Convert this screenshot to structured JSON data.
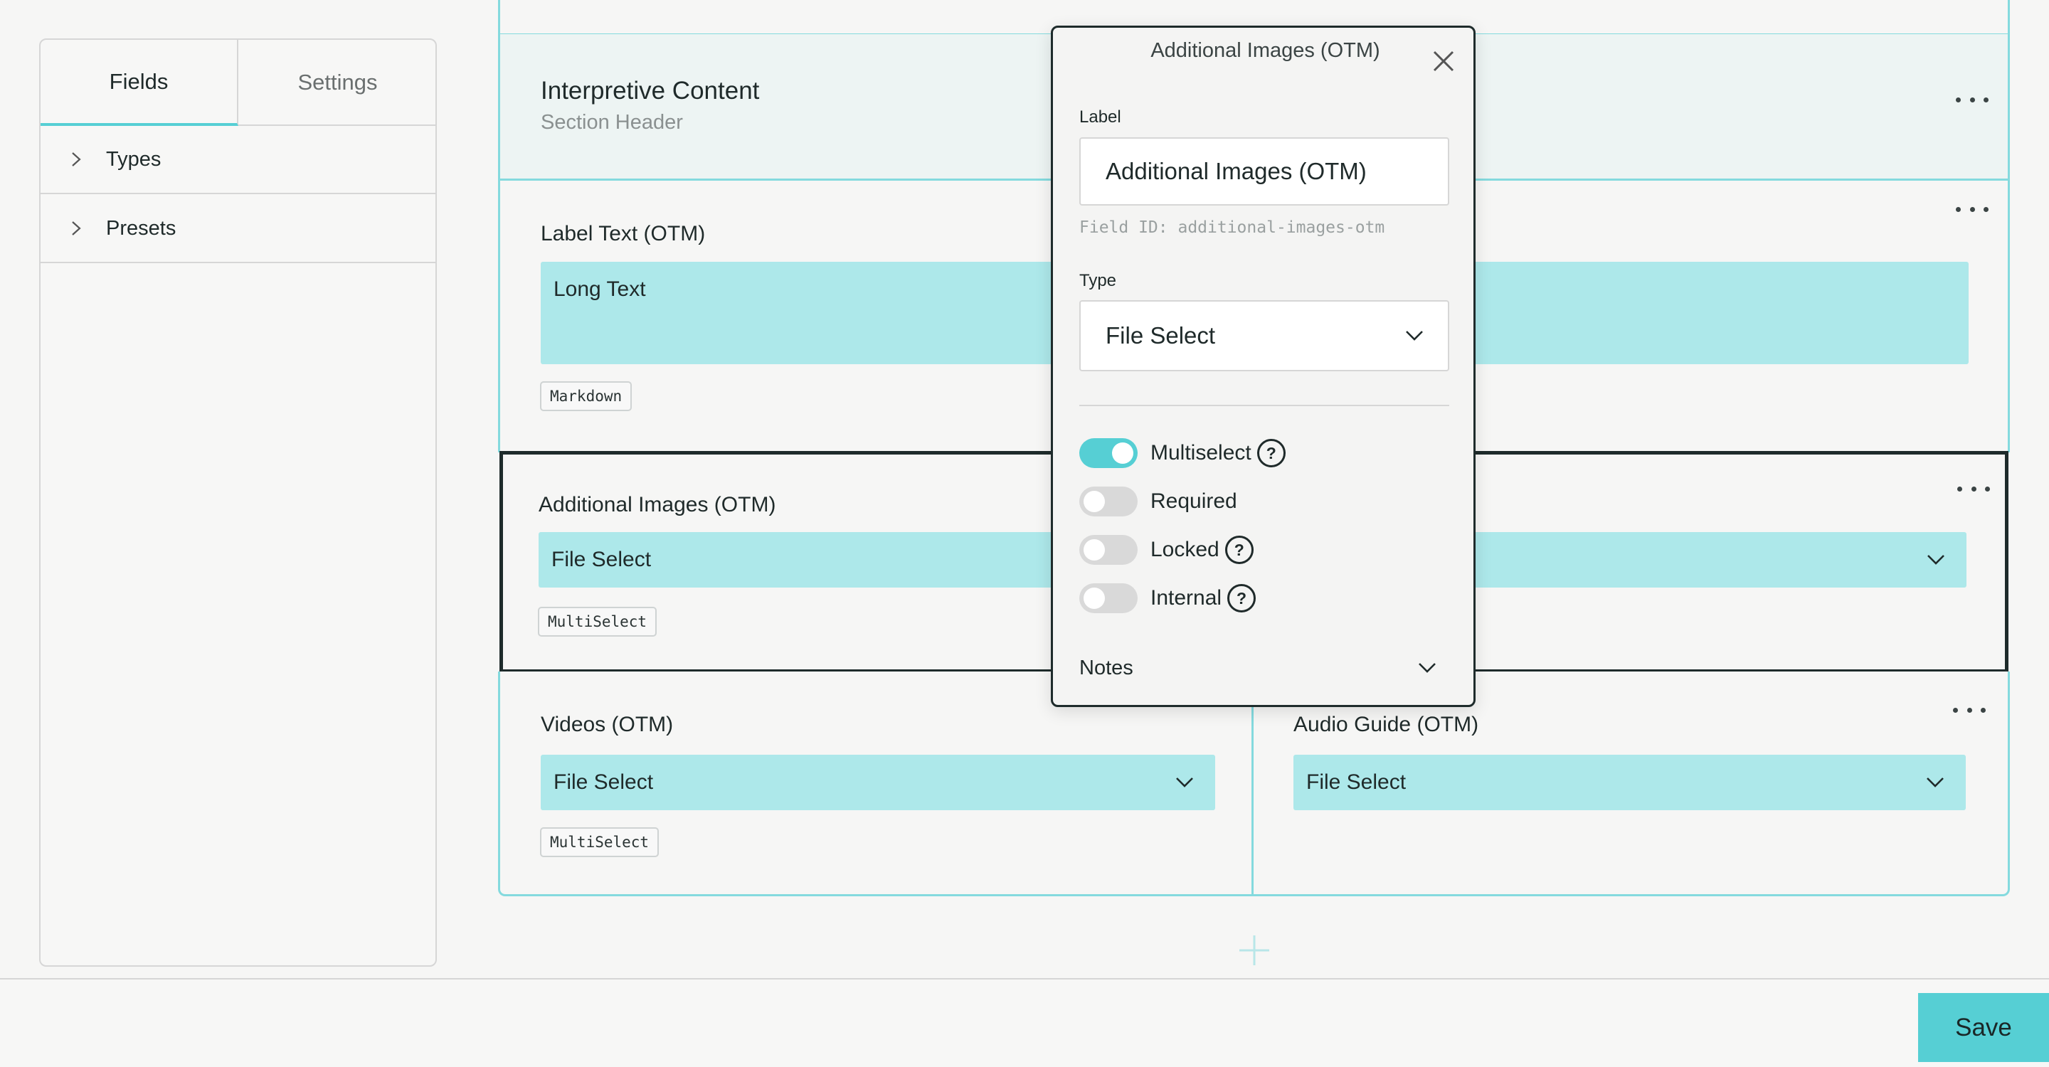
{
  "sidebar": {
    "tabs": [
      {
        "label": "Fields",
        "active": true
      },
      {
        "label": "Settings",
        "active": false
      }
    ],
    "items": [
      {
        "label": "Types",
        "icon": "chevron-right-icon"
      },
      {
        "label": "Presets",
        "icon": "chevron-right-icon"
      }
    ]
  },
  "section": {
    "title": "Interpretive Content",
    "subtitle": "Section Header"
  },
  "fields": {
    "label_text": {
      "label": "Label Text (OTM)",
      "value": "Long Text",
      "tag": "Markdown"
    },
    "additional_images": {
      "label": "Additional Images (OTM)",
      "value": "File Select",
      "tag": "MultiSelect"
    },
    "videos": {
      "label": "Videos (OTM)",
      "value": "File Select",
      "tag": "MultiSelect"
    },
    "audio_guide": {
      "label": "Audio Guide (OTM)",
      "value": "File Select"
    }
  },
  "modal": {
    "title": "Additional Images (OTM)",
    "label_caption": "Label",
    "label_value": "Additional Images (OTM)",
    "field_id": "Field ID: additional-images-otm",
    "type_caption": "Type",
    "type_value": "File Select",
    "toggles": [
      {
        "label": "Multiselect",
        "on": true,
        "help": true
      },
      {
        "label": "Required",
        "on": false,
        "help": false
      },
      {
        "label": "Locked",
        "on": false,
        "help": true
      },
      {
        "label": "Internal",
        "on": false,
        "help": true
      }
    ],
    "help_glyph": "?",
    "notes_label": "Notes"
  },
  "footer": {
    "save_label": "Save"
  },
  "colors": {
    "accent": "#56cfd4",
    "field_fill": "#ade8ea",
    "section_border": "#84dade",
    "selected_border": "#1e2b2b"
  }
}
